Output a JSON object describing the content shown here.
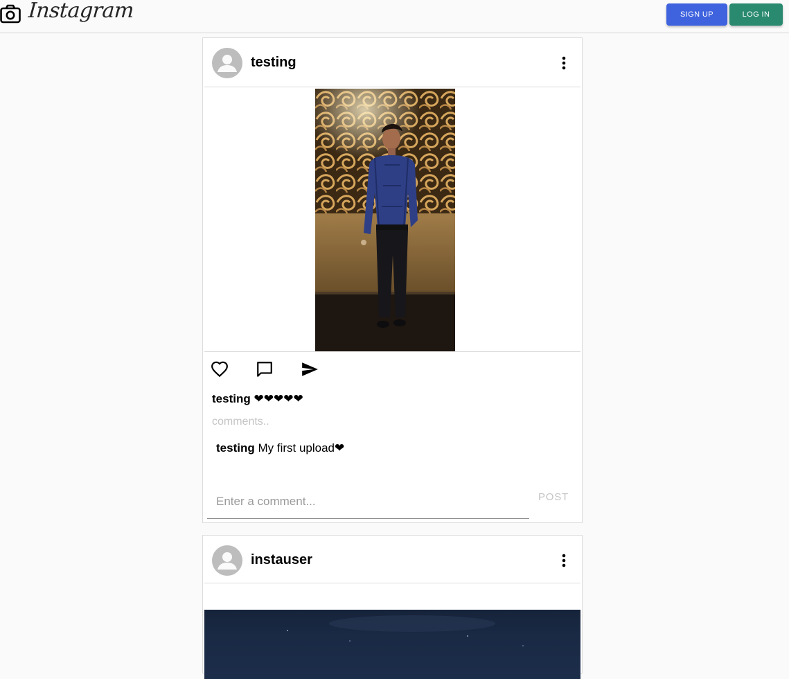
{
  "header": {
    "brand": "Instagram",
    "camera_icon": "camera-icon",
    "signup_label": "SIGN UP",
    "login_label": "LOG IN",
    "signup_color": "#3f63de",
    "login_color": "#2a8a6f"
  },
  "posts": [
    {
      "username": "testing",
      "caption_user": "testing",
      "caption_text": "❤❤❤❤❤",
      "comments_link": "comments..",
      "comments": [
        {
          "user": "testing",
          "text": "My first upload❤"
        }
      ],
      "comment_placeholder": "Enter a comment...",
      "post_label": "POST",
      "icons": [
        "heart-icon",
        "comment-icon",
        "send-icon",
        "more-vertical-icon"
      ]
    },
    {
      "username": "instauser",
      "icons": [
        "more-vertical-icon"
      ]
    }
  ]
}
